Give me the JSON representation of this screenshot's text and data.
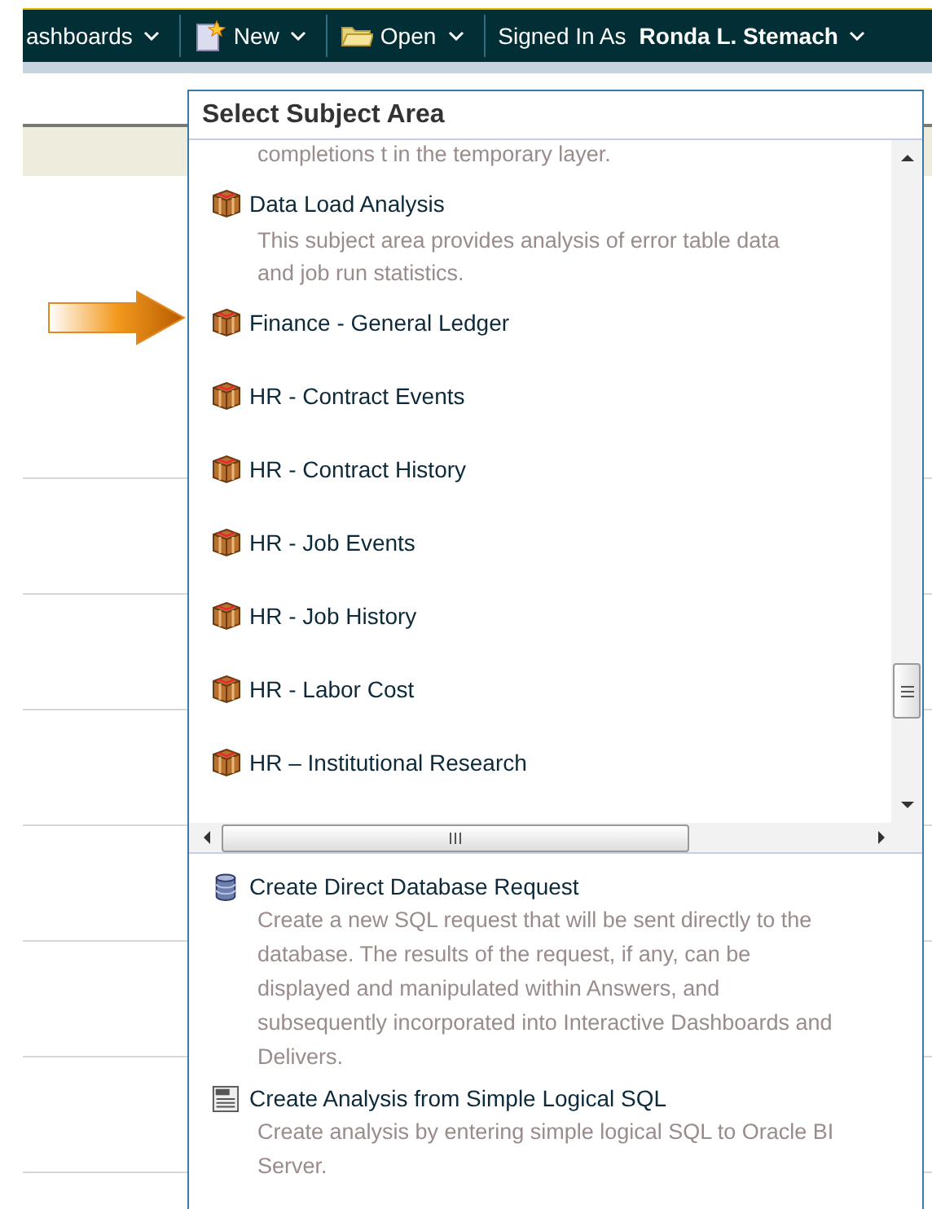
{
  "menu_bar": {
    "items": [
      {
        "label": "ashboards",
        "kind": "plain"
      },
      {
        "label": "New",
        "kind": "new"
      },
      {
        "label": "Open",
        "kind": "open"
      }
    ],
    "signed_in_label": "Signed In As",
    "user": "Ronda L. Stemach"
  },
  "popup": {
    "title": "Select Subject Area",
    "subject_areas": [
      {
        "description": "completions t in the temporary layer."
      },
      {
        "name": "Data Load Analysis",
        "description": "This subject area provides analysis of error table data\nand job run statistics."
      },
      {
        "name": "Finance - General Ledger"
      },
      {
        "name": "HR - Contract Events"
      },
      {
        "name": "HR - Contract History"
      },
      {
        "name": "HR - Job Events"
      },
      {
        "name": "HR - Job History"
      },
      {
        "name": "HR - Labor Cost"
      },
      {
        "name": "HR – Institutional Research"
      }
    ],
    "actions": [
      {
        "kind": "database",
        "title": "Create Direct Database Request",
        "description": "Create a new SQL request that will be sent directly to the\ndatabase. The results of the request, if any, can be\ndisplayed and manipulated within Answers, and\nsubsequently incorporated into Interactive Dashboards and\nDelivers."
      },
      {
        "kind": "sql",
        "title": "Create Analysis from Simple Logical SQL",
        "description": "Create analysis by entering simple logical SQL to Oracle BI\nServer."
      }
    ]
  }
}
